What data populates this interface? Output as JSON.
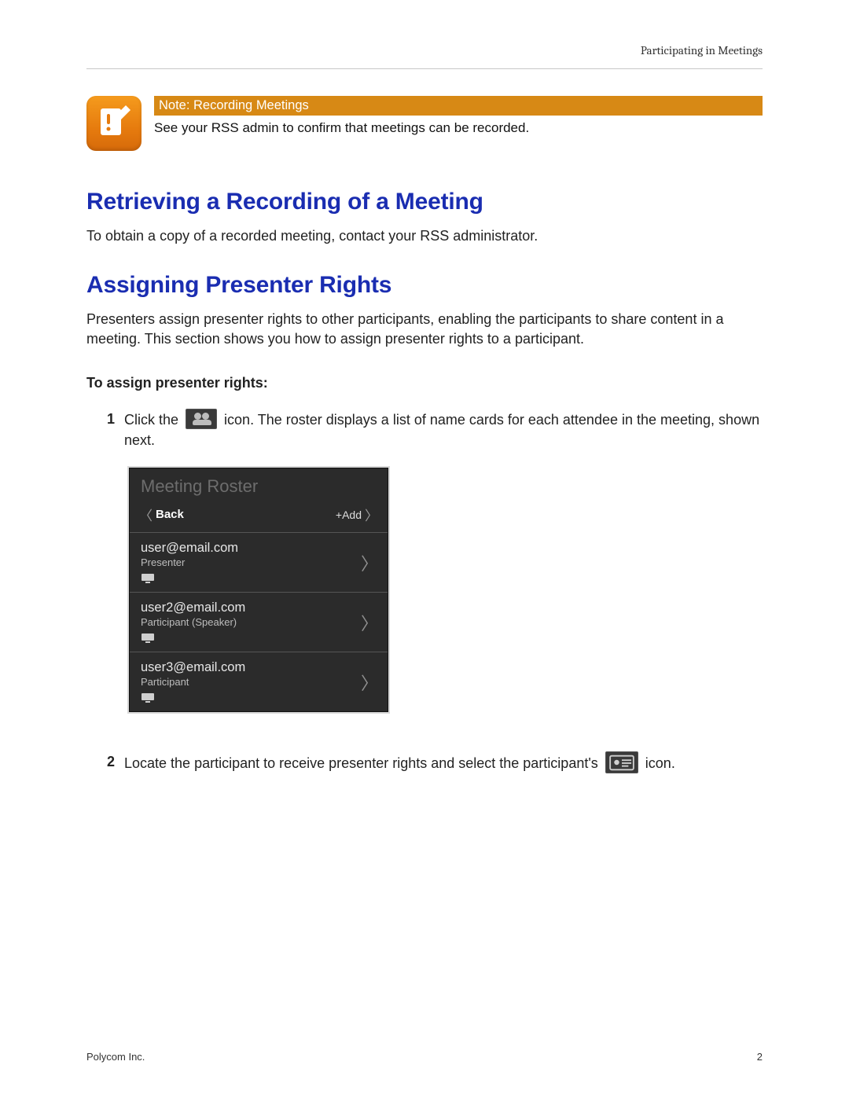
{
  "running_head": "Participating in Meetings",
  "note": {
    "bar": "Note: Recording Meetings",
    "text": "See your RSS admin to confirm that meetings can be recorded."
  },
  "section1": {
    "heading": "Retrieving a Recording of a Meeting",
    "body": "To obtain a copy of a recorded meeting, contact your RSS administrator."
  },
  "section2": {
    "heading": "Assigning Presenter Rights",
    "body": "Presenters assign presenter rights to other participants, enabling the participants to share content in a meeting. This section shows you how to assign presenter rights to a participant.",
    "subhead": "To assign presenter rights:",
    "step1_a": "Click the ",
    "step1_b": " icon. The roster displays a list of name cards for each attendee in the meeting, shown next.",
    "step2_a": "Locate the participant to receive presenter rights and select the participant's ",
    "step2_b": " icon."
  },
  "roster": {
    "title": "Meeting Roster",
    "back": "Back",
    "add": "+Add",
    "items": [
      {
        "email": "user@email.com",
        "role": "Presenter"
      },
      {
        "email": "user2@email.com",
        "role": "Participant (Speaker)"
      },
      {
        "email": "user3@email.com",
        "role": "Participant"
      }
    ]
  },
  "footer": {
    "left": "Polycom Inc.",
    "right": "2"
  },
  "nums": {
    "n1": "1",
    "n2": "2"
  }
}
